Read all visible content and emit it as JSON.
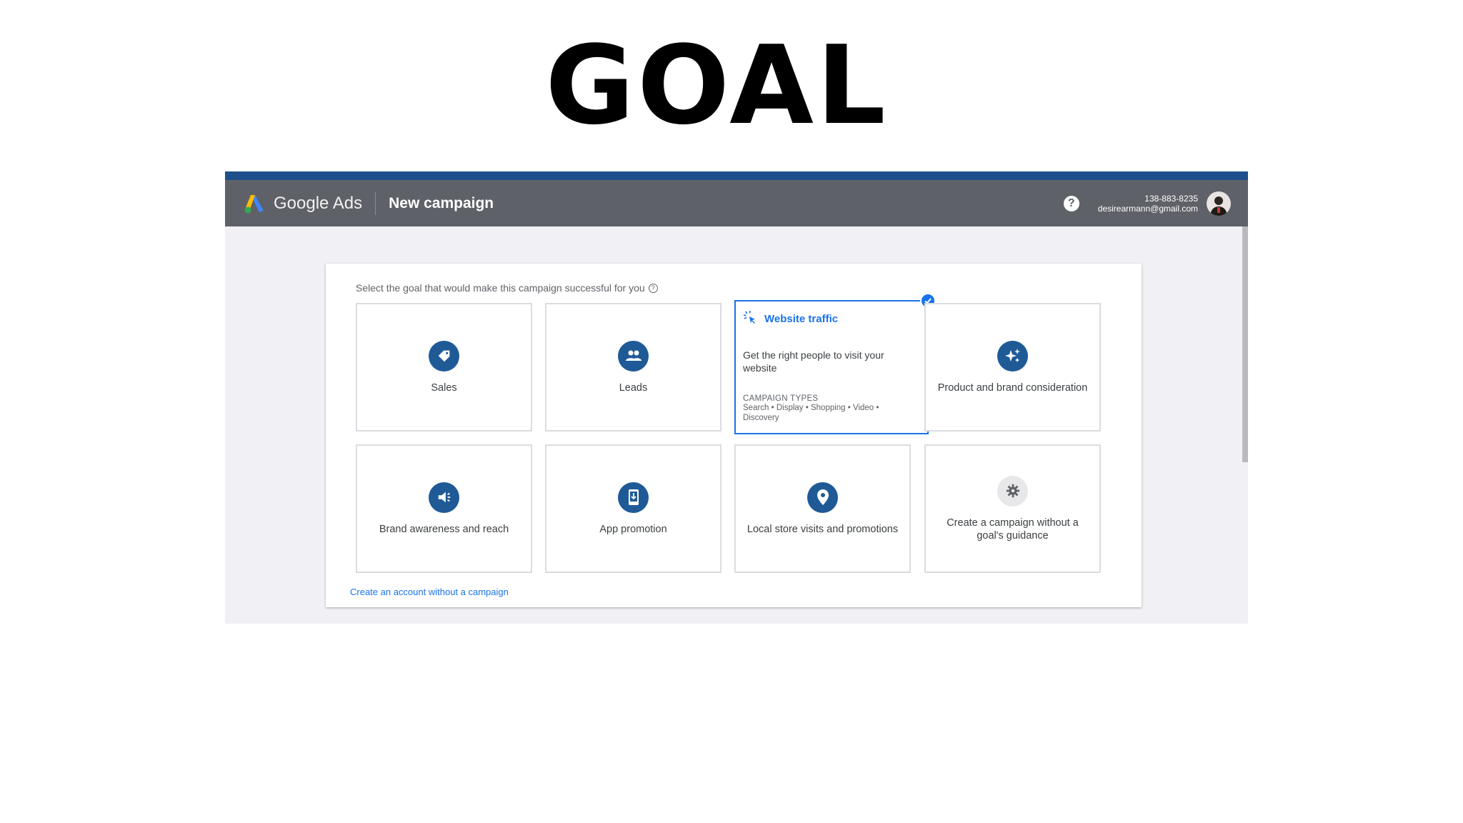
{
  "headline": "GOAL",
  "app": {
    "brand": "Google Ads",
    "page_title": "New campaign",
    "account_id": "138-883-8235",
    "account_email": "desirearmann@gmail.com"
  },
  "prompt": "Select the goal that would make this campaign successful for you",
  "goals": [
    {
      "label": "Sales",
      "icon": "tag-icon"
    },
    {
      "label": "Leads",
      "icon": "people-icon"
    },
    {
      "label": "Website traffic",
      "icon": "sparkle-click-icon",
      "selected": true,
      "description": "Get the right people to visit your website",
      "types_heading": "CAMPAIGN TYPES",
      "types": "Search • Display • Shopping • Video • Discovery"
    },
    {
      "label": "Product and brand consideration",
      "icon": "sparkles-icon"
    },
    {
      "label": "Brand awareness and reach",
      "icon": "megaphone-icon"
    },
    {
      "label": "App promotion",
      "icon": "phone-download-icon"
    },
    {
      "label": "Local store visits and promotions",
      "icon": "location-pin-icon"
    },
    {
      "label": "Create a campaign without a goal's guidance",
      "icon": "gear-icon"
    }
  ],
  "footer_link": "Create an account without a campaign",
  "colors": {
    "accent": "#1a73e8",
    "icon_circle": "#1f5a97",
    "topbar": "#5f6168"
  }
}
